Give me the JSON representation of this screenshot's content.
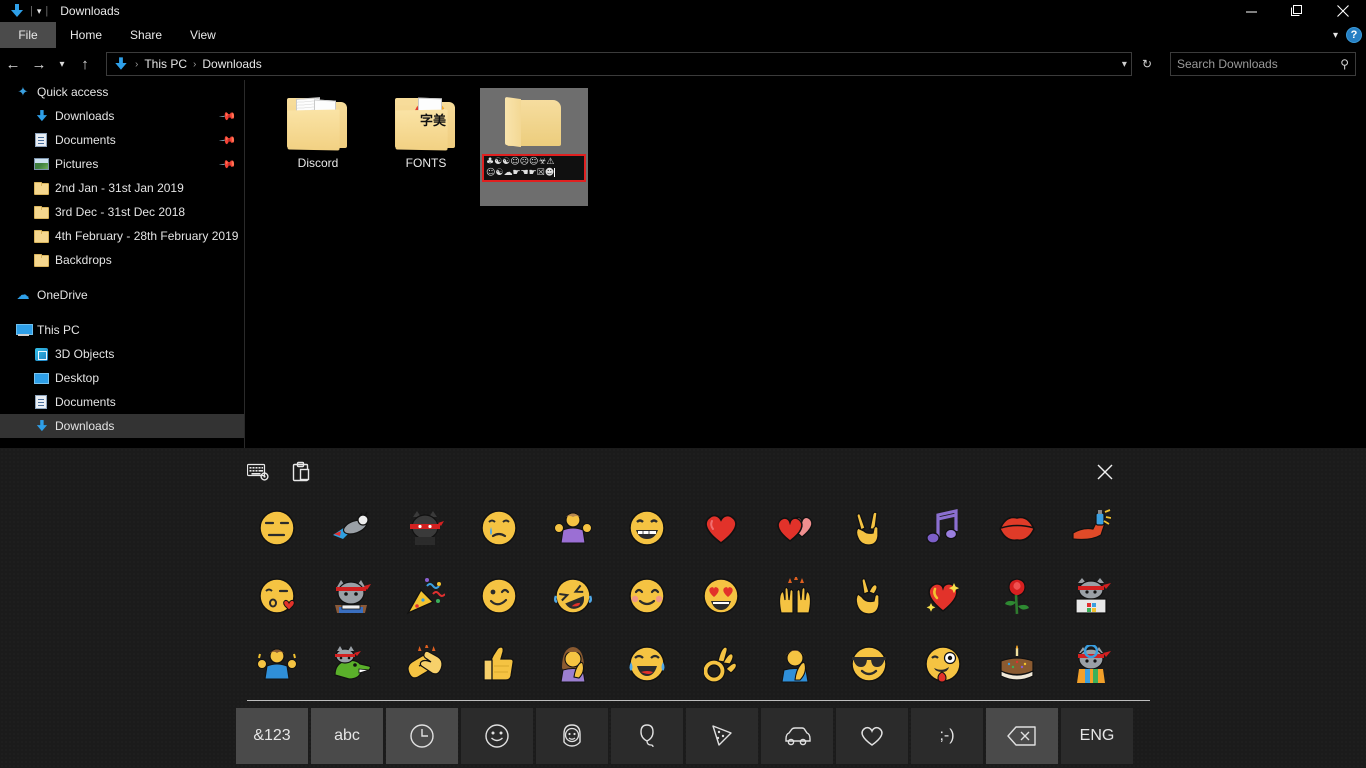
{
  "window": {
    "title": "Downloads",
    "quick_access_icon": "download-arrow-icon",
    "quick_access_chevron": "chevron-down-icon",
    "minimize_label": "Minimize",
    "maximize_label": "Restore",
    "close_label": "Close"
  },
  "ribbon": {
    "tabs": [
      {
        "label": "File",
        "active": true
      },
      {
        "label": "Home",
        "active": false
      },
      {
        "label": "Share",
        "active": false
      },
      {
        "label": "View",
        "active": false
      }
    ],
    "collapse_icon": "chevron-down-icon",
    "help_label": "?"
  },
  "address_bar": {
    "back_icon": "arrow-left-icon",
    "forward_icon": "arrow-right-icon",
    "recent_icon": "chevron-down-icon",
    "up_icon": "arrow-up-icon",
    "breadcrumb": [
      {
        "label": "This PC"
      },
      {
        "label": "Downloads"
      }
    ],
    "breadcrumb_dropdown_icon": "chevron-down-icon",
    "refresh_icon": "refresh-icon",
    "search_placeholder": "Search Downloads",
    "search_value": "",
    "search_icon": "magnifier-icon"
  },
  "sidebar": {
    "groups": [
      {
        "header": {
          "label": "Quick access",
          "icon": "star-icon"
        },
        "items": [
          {
            "label": "Downloads",
            "icon": "download-arrow-icon",
            "pinned": true
          },
          {
            "label": "Documents",
            "icon": "document-icon",
            "pinned": true
          },
          {
            "label": "Pictures",
            "icon": "picture-icon",
            "pinned": true
          },
          {
            "label": "2nd Jan - 31st Jan 2019",
            "icon": "folder-icon",
            "pinned": false
          },
          {
            "label": "3rd Dec - 31st Dec 2018",
            "icon": "folder-icon",
            "pinned": false
          },
          {
            "label": "4th February - 28th February 2019",
            "icon": "folder-icon",
            "pinned": false
          },
          {
            "label": "Backdrops",
            "icon": "folder-icon",
            "pinned": false
          }
        ]
      },
      {
        "header": {
          "label": "OneDrive",
          "icon": "cloud-icon"
        },
        "items": []
      },
      {
        "header": {
          "label": "This PC",
          "icon": "monitor-icon"
        },
        "items": [
          {
            "label": "3D Objects",
            "icon": "3d-object-icon",
            "pinned": false
          },
          {
            "label": "Desktop",
            "icon": "desktop-icon",
            "pinned": false
          },
          {
            "label": "Documents",
            "icon": "document-icon",
            "pinned": false
          },
          {
            "label": "Downloads",
            "icon": "download-arrow-icon",
            "pinned": false,
            "selected": true
          }
        ]
      }
    ]
  },
  "content": {
    "items": [
      {
        "name": "Discord",
        "icon": "folder-with-documents-icon",
        "selected": false,
        "renaming": false
      },
      {
        "name": "FONTS",
        "icon": "folder-with-cd-icon",
        "cd_text": "字美",
        "selected": false,
        "renaming": false
      },
      {
        "name": "",
        "icon": "plain-folder-icon",
        "selected": true,
        "renaming": true,
        "rename_line_1": "♣☯☯☺☹☺☣⚠",
        "rename_line_2": "☺☯☁☛☚☛☒☻"
      }
    ]
  },
  "emoji_panel": {
    "settings_icon": "keyboard-settings-icon",
    "clipboard_icon": "clipboard-history-icon",
    "close_icon": "close-icon",
    "rows": [
      [
        {
          "glyph": "😒",
          "name": "unamused-face-emoji"
        },
        {
          "glyph": "🐱",
          "name": "ninja-cat-rocket-emoji"
        },
        {
          "glyph": "🐱",
          "name": "ninja-cat-emoji"
        },
        {
          "glyph": "😢",
          "name": "crying-face-emoji"
        },
        {
          "glyph": "🤷",
          "name": "person-shrugging-emoji"
        },
        {
          "glyph": "😁",
          "name": "beaming-face-emoji"
        },
        {
          "glyph": "❤",
          "name": "red-heart-emoji"
        },
        {
          "glyph": "💕",
          "name": "two-hearts-emoji"
        },
        {
          "glyph": "✌",
          "name": "victory-hand-emoji"
        },
        {
          "glyph": "🎵",
          "name": "musical-notes-emoji"
        },
        {
          "glyph": "💋",
          "name": "kiss-mark-emoji"
        },
        {
          "glyph": "💪",
          "name": "flexed-arm-spray-emoji"
        }
      ],
      [
        {
          "glyph": "😘",
          "name": "face-blowing-kiss-emoji"
        },
        {
          "glyph": "🐱",
          "name": "studying-ninja-cat-emoji"
        },
        {
          "glyph": "🎉",
          "name": "party-popper-emoji"
        },
        {
          "glyph": "😉",
          "name": "winking-face-emoji"
        },
        {
          "glyph": "🤣",
          "name": "rolling-on-floor-laughing-emoji"
        },
        {
          "glyph": "😊",
          "name": "smiling-face-smiling-eyes-emoji"
        },
        {
          "glyph": "😍",
          "name": "smiling-face-heart-eyes-emoji"
        },
        {
          "glyph": "🙌",
          "name": "raising-hands-emoji"
        },
        {
          "glyph": "🤞",
          "name": "crossed-fingers-emoji"
        },
        {
          "glyph": "💖",
          "name": "sparkling-heart-emoji"
        },
        {
          "glyph": "🌹",
          "name": "rose-emoji"
        },
        {
          "glyph": "🐱",
          "name": "ninja-cat-window-box-emoji"
        }
      ],
      [
        {
          "glyph": "🤷‍♂",
          "name": "man-shrugging-emoji"
        },
        {
          "glyph": "🦖",
          "name": "ninja-cat-dino-emoji"
        },
        {
          "glyph": "👏",
          "name": "clapping-hands-emoji"
        },
        {
          "glyph": "👍",
          "name": "thumbs-up-emoji"
        },
        {
          "glyph": "🤦‍♀",
          "name": "woman-facepalming-emoji"
        },
        {
          "glyph": "😂",
          "name": "face-with-tears-of-joy-emoji"
        },
        {
          "glyph": "👌",
          "name": "ok-hand-emoji"
        },
        {
          "glyph": "🤦‍♂",
          "name": "man-facepalming-emoji"
        },
        {
          "glyph": "😎",
          "name": "smiling-face-sunglasses-emoji"
        },
        {
          "glyph": "🤪",
          "name": "zany-face-emoji"
        },
        {
          "glyph": "🎂",
          "name": "birthday-cake-emoji"
        },
        {
          "glyph": "🐱",
          "name": "ninja-cat-hero-emoji"
        }
      ]
    ],
    "bottom_keys": [
      {
        "label": "&123",
        "name": "symbols-key",
        "icon": null,
        "active": true
      },
      {
        "label": "abc",
        "name": "letters-key",
        "icon": null,
        "active": true
      },
      {
        "label": "",
        "name": "recent-emoji-key",
        "icon": "clock-icon",
        "active": true
      },
      {
        "label": "",
        "name": "smileys-emoji-key",
        "icon": "smiley-icon",
        "active": false
      },
      {
        "label": "",
        "name": "people-emoji-key",
        "icon": "person-icon",
        "active": false
      },
      {
        "label": "",
        "name": "celebration-emoji-key",
        "icon": "balloon-icon",
        "active": false
      },
      {
        "label": "",
        "name": "food-emoji-key",
        "icon": "pizza-icon",
        "active": false
      },
      {
        "label": "",
        "name": "transport-emoji-key",
        "icon": "car-icon",
        "active": false
      },
      {
        "label": "",
        "name": "symbols-heart-key",
        "icon": "heart-icon",
        "active": false
      },
      {
        "label": ";-)",
        "name": "kaomoji-key",
        "icon": null,
        "active": false
      },
      {
        "label": "",
        "name": "backspace-key",
        "icon": "backspace-icon",
        "active": true
      },
      {
        "label": "ENG",
        "name": "language-key",
        "icon": null,
        "active": false
      }
    ]
  },
  "colors": {
    "accent_blue": "#2e9fe8",
    "folder_yellow": "#f2d183",
    "selection_gray": "#6e6e6e",
    "rename_border_red": "#e02020",
    "panel_bg": "#1b1b1b",
    "window_bg": "#000000"
  }
}
